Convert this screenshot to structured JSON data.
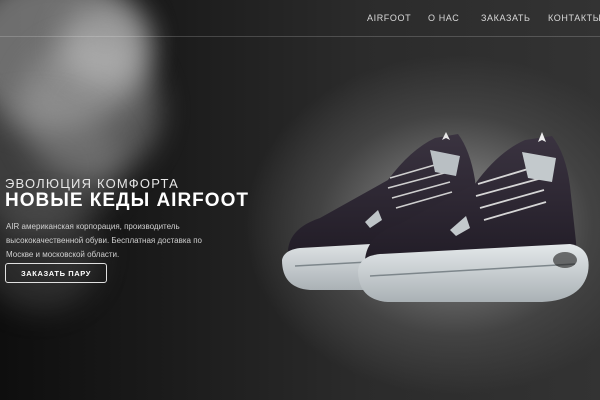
{
  "nav": {
    "items": [
      {
        "label": "AIRFOOT"
      },
      {
        "label": "О НАС"
      },
      {
        "label": "ЗАКАЗАТЬ"
      },
      {
        "label": "КОНТАКТЫ"
      }
    ]
  },
  "hero": {
    "tagline": "ЭВОЛЮЦИЯ КОМФОРТА",
    "headline": "НОВЫЕ КЕДЫ AIRFOOT",
    "description": "AIR американская корпорация, производитель высококачественной обуви. Бесплатная доставка по Москве и московской области.",
    "cta_label": "ЗАКАЗАТЬ ПАРУ"
  },
  "colors": {
    "background": "#2a2a2a",
    "spotlight": "#8c8c8c",
    "text": "#ffffff",
    "shoe_upper": "#2a2430",
    "shoe_sole": "#d6dbde"
  }
}
